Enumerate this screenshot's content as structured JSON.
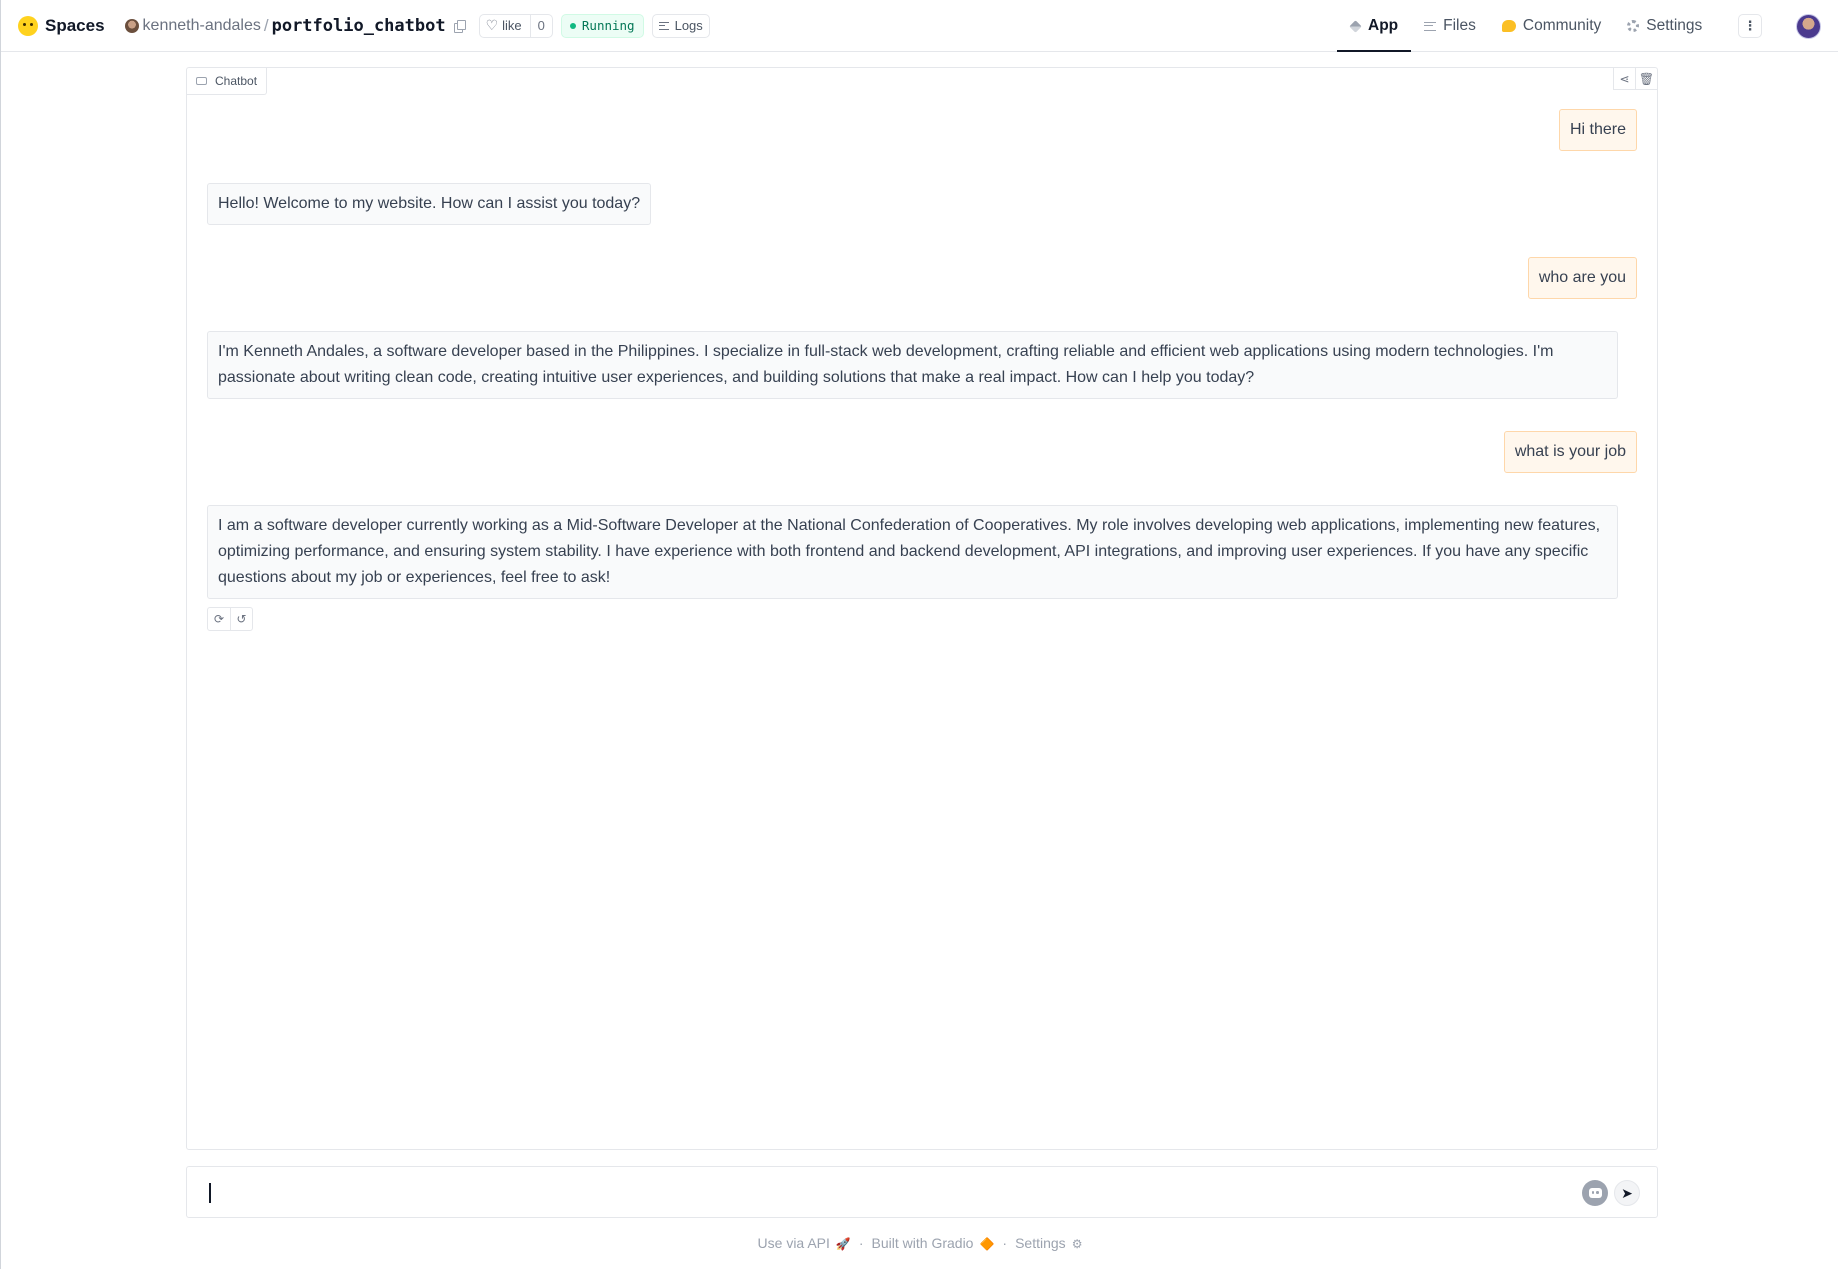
{
  "header": {
    "brand": "Spaces",
    "owner": "kenneth-andales",
    "separator": "/",
    "repo": "portfolio_chatbot",
    "like_label": "like",
    "like_count": "0",
    "status": "Running",
    "logs_label": "Logs",
    "tabs": [
      {
        "label": "App",
        "icon": "cube-icon"
      },
      {
        "label": "Files",
        "icon": "files-icon"
      },
      {
        "label": "Community",
        "icon": "community-icon"
      },
      {
        "label": "Settings",
        "icon": "gear-icon"
      }
    ],
    "more_label": "⋮"
  },
  "chatbot": {
    "label": "Chatbot",
    "messages": [
      {
        "role": "user",
        "text": "Hi there"
      },
      {
        "role": "bot",
        "text": "Hello! Welcome to my website. How can I assist you today?"
      },
      {
        "role": "user",
        "text": "who are you"
      },
      {
        "role": "bot",
        "text": "I'm Kenneth Andales, a software developer based in the Philippines. I specialize in full-stack web development, crafting reliable and efficient web applications using modern technologies. I'm passionate about writing clean code, creating intuitive user experiences, and building solutions that make a real impact. How can I help you today?"
      },
      {
        "role": "user",
        "text": "what is your job"
      },
      {
        "role": "bot",
        "text": "I am a software developer currently working as a Mid-Software Developer at the National Confederation of Cooperatives. My role involves developing web applications, implementing new features, optimizing performance, and ensuring system stability. I have experience with both frontend and backend development, API integrations, and improving user experiences. If you have any specific questions about my job or experiences, feel free to ask!"
      }
    ]
  },
  "input": {
    "value": "",
    "placeholder": ""
  },
  "footer": {
    "api_label": "Use via API",
    "api_emoji": "🚀",
    "dot": "·",
    "built_label": "Built with Gradio",
    "built_emoji": "🔶",
    "settings_label": "Settings",
    "settings_emoji": "⚙"
  },
  "colors": {
    "user_bubble": "#fff7ed",
    "user_border": "#fed7aa",
    "bot_bubble": "#f9fafb",
    "status_green": "#10b981",
    "brand_yellow": "#ffd21e"
  }
}
